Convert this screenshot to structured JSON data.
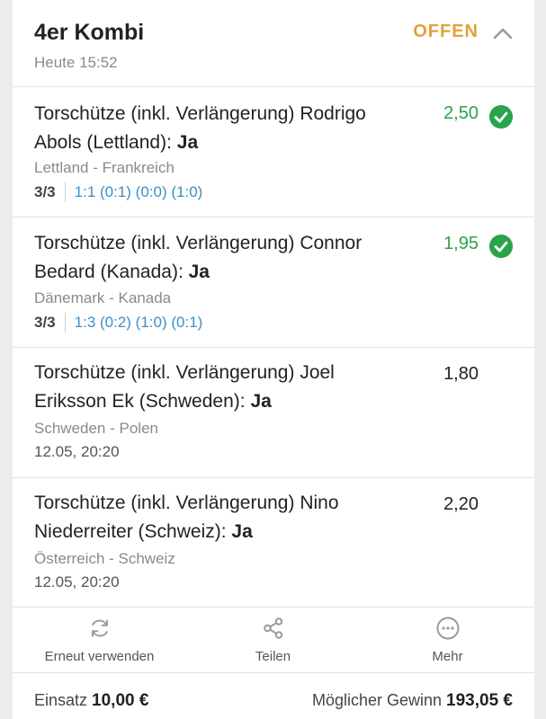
{
  "header": {
    "title": "4er Kombi",
    "time": "Heute 15:52",
    "status": "OFFEN",
    "colors": {
      "status": "#e3a03a",
      "won": "#2aa44a",
      "score": "#3d8fc4"
    }
  },
  "bets": [
    {
      "market": "Torschütze (inkl. Verlängerung) Rodrigo Abols (Lettland): ",
      "pick": "Ja",
      "odds": "2,50",
      "status_icon": "check-circle-icon",
      "match": "Lettland - Frankreich",
      "count": "3/3",
      "score": "1:1 (0:1) (0:0) (1:0)"
    },
    {
      "market": "Torschütze (inkl. Verlängerung) Connor Bedard (Kanada): ",
      "pick": "Ja",
      "odds": "1,95",
      "status_icon": "check-circle-icon",
      "match": "Dänemark - Kanada",
      "count": "3/3",
      "score": "1:3 (0:2) (1:0) (0:1)"
    },
    {
      "market": "Torschütze (inkl. Verlängerung) Joel Eriksson Ek (Schweden): ",
      "pick": "Ja",
      "odds": "1,80",
      "match": "Schweden - Polen",
      "date": "12.05, 20:20"
    },
    {
      "market": "Torschütze (inkl. Verlängerung) Nino Niederreiter (Schweiz): ",
      "pick": "Ja",
      "odds": "2,20",
      "match": "Österreich - Schweiz",
      "date": "12.05, 20:20"
    }
  ],
  "actions": [
    {
      "label": "Erneut verwenden",
      "icon": "refresh-icon"
    },
    {
      "label": "Teilen",
      "icon": "share-icon"
    },
    {
      "label": "Mehr",
      "icon": "more-icon"
    }
  ],
  "footer": {
    "stake_label": "Einsatz ",
    "stake_value": "10,00 €",
    "win_label": "Möglicher Gewinn ",
    "win_value": "193,05 €"
  }
}
